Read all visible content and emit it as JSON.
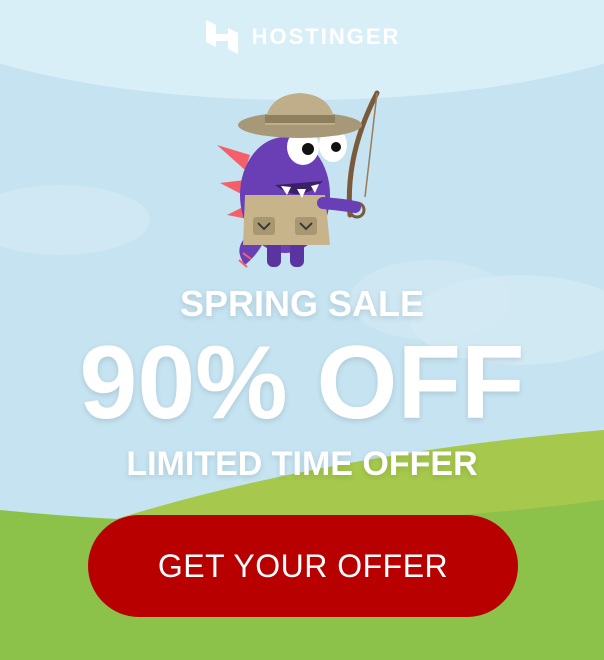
{
  "brand": {
    "name": "HOSTINGER",
    "logo_icon": "hostinger-h-logo"
  },
  "mascot": {
    "icon": "purple-monster-fishing-mascot"
  },
  "promo": {
    "sale_label": "SPRING SALE",
    "discount": "90% OFF",
    "subtitle": "LIMITED TIME OFFER"
  },
  "cta": {
    "label": "GET YOUR OFFER"
  },
  "colors": {
    "sky": "#c5e3f1",
    "sky_light": "#d8eef7",
    "grass": "#8cc24a",
    "grass_dark": "#a6c84c",
    "cta": "#b90000",
    "mascot_purple": "#6a3fb5",
    "vest": "#c7b48a",
    "hat": "#a79878"
  }
}
